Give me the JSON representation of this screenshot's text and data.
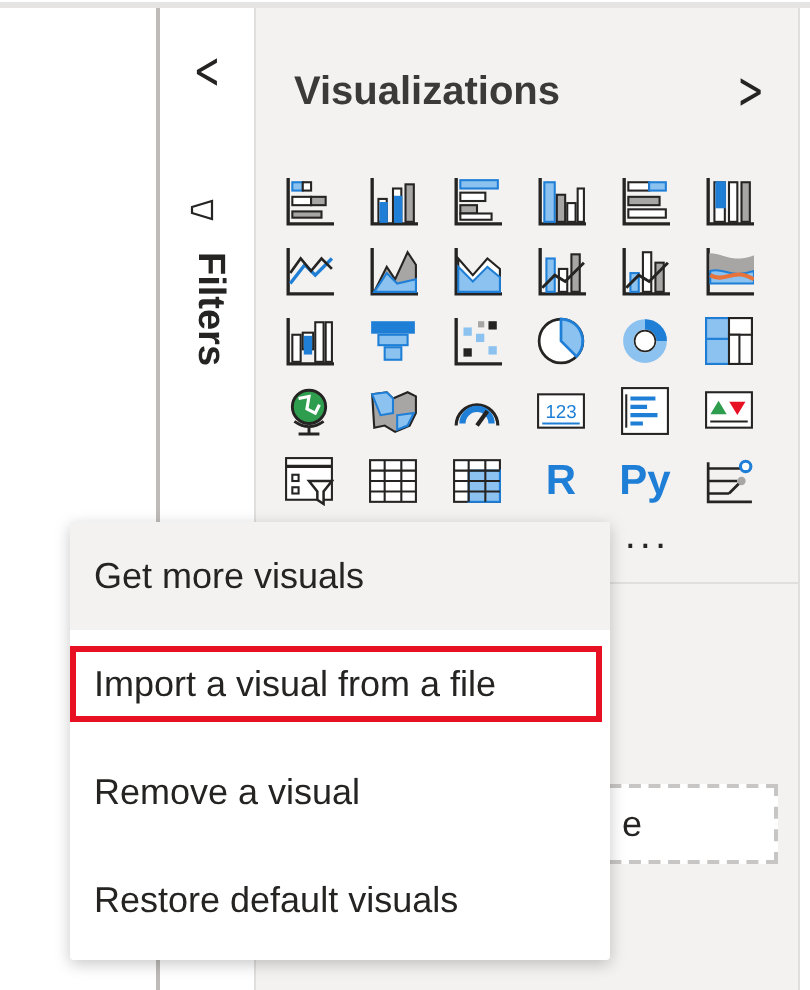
{
  "filters_pane": {
    "collapse_glyph": "<",
    "title": "Filters"
  },
  "visualizations_pane": {
    "title": "Visualizations",
    "expand_glyph": ">",
    "card_visual_label": "123",
    "script_visuals": [
      "R",
      "Py"
    ],
    "more": "...",
    "field_well_text": "e"
  },
  "context_menu": [
    {
      "label": "Get more visuals",
      "highlighted": true,
      "outlined": false
    },
    {
      "label": "Import a visual from a file",
      "highlighted": false,
      "outlined": true
    },
    {
      "label": "Remove a visual",
      "highlighted": false,
      "outlined": false
    },
    {
      "label": "Restore default visuals",
      "highlighted": false,
      "outlined": false
    }
  ]
}
